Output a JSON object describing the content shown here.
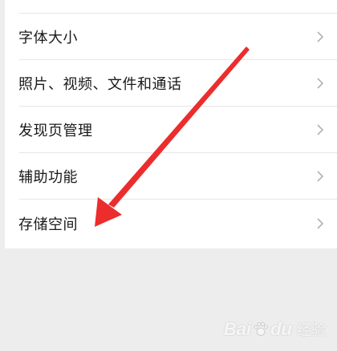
{
  "settings": {
    "items": [
      {
        "label": "字体大小"
      },
      {
        "label": "照片、视频、文件和通话"
      },
      {
        "label": "发现页管理"
      },
      {
        "label": "辅助功能"
      },
      {
        "label": "存储空间"
      }
    ]
  },
  "icons": {
    "chevron": "chevron-right-icon",
    "annotation": "red-arrow-annotation",
    "watermark_paw": "paw-icon"
  },
  "colors": {
    "background": "#ededed",
    "card": "#ffffff",
    "text": "#191919",
    "chevron": "#b2b2b2",
    "arrow": "#ec2d2d"
  },
  "watermark": {
    "brand": "Bai",
    "brand_tail": "du",
    "suffix": "经验"
  }
}
